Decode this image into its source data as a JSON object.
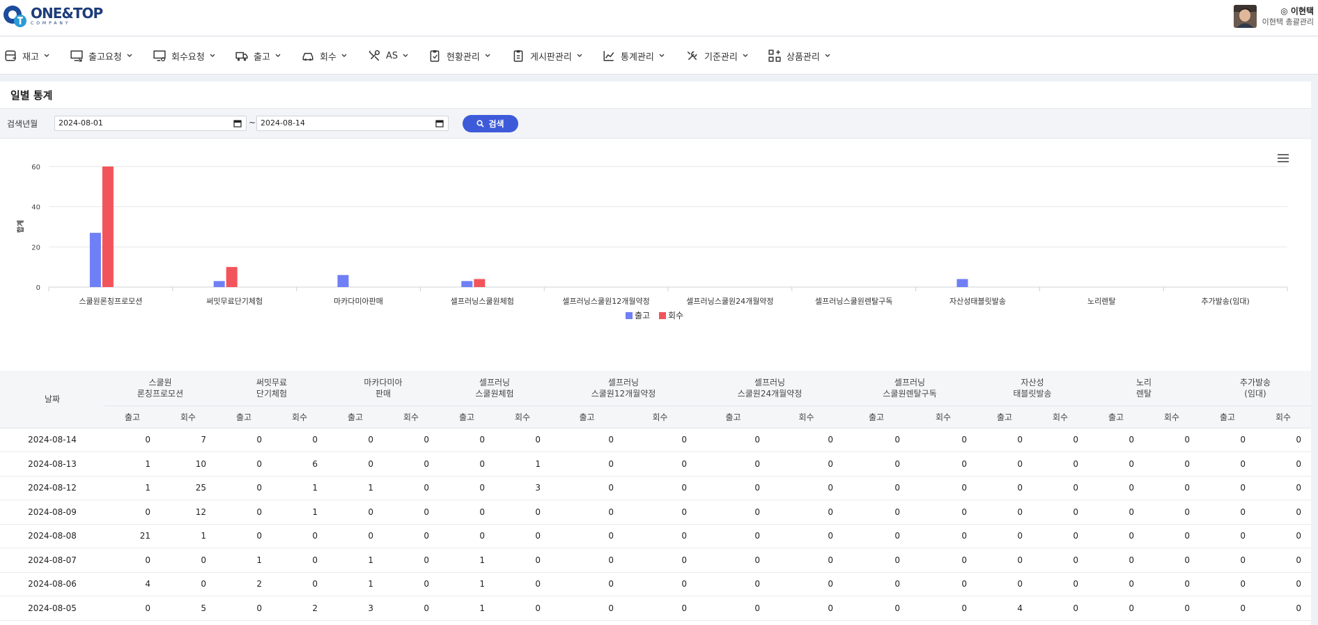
{
  "header": {
    "logo_name": "ONE&TOP",
    "logo_sub": "COMPANY",
    "user_name": "◎ 이현택",
    "user_role": "이현택 총괄관리"
  },
  "nav": [
    {
      "label": "재고",
      "icon": "inventory-icon"
    },
    {
      "label": "출고요청",
      "icon": "monitor-export-icon"
    },
    {
      "label": "회수요청",
      "icon": "monitor-search-icon"
    },
    {
      "label": "출고",
      "icon": "truck-icon"
    },
    {
      "label": "회수",
      "icon": "car-icon"
    },
    {
      "label": "AS",
      "icon": "tools-icon"
    },
    {
      "label": "현황관리",
      "icon": "clipboard-icon"
    },
    {
      "label": "게시판관리",
      "icon": "board-icon"
    },
    {
      "label": "통계관리",
      "icon": "line-chart-icon"
    },
    {
      "label": "기준관리",
      "icon": "wrench-icon"
    },
    {
      "label": "상품관리",
      "icon": "grid-plus-icon"
    }
  ],
  "page": {
    "title": "일별 통계"
  },
  "search": {
    "label": "검색년월",
    "start": "2024-08-01",
    "end": "2024-08-14",
    "tilde": "~",
    "button": "검색"
  },
  "chart_data": {
    "type": "bar",
    "title": "",
    "xlabel": "",
    "ylabel": "합계",
    "ylim": [
      0,
      60
    ],
    "yticks": [
      0,
      20,
      40,
      60
    ],
    "grid": true,
    "legend": "bottom",
    "categories": [
      "스쿨원론칭프로모션",
      "써밋무료단기체험",
      "마카다미아판매",
      "셀프러닝스쿨원체험",
      "셀프러닝스쿨원12개월약정",
      "셀프러닝스쿨원24개월약정",
      "셀프러닝스쿨원렌탈구독",
      "자산성태블릿발송",
      "노리렌탈",
      "추가발송(임대)"
    ],
    "series": [
      {
        "name": "출고",
        "color": "#6f7ff5",
        "values": [
          27,
          3,
          6,
          3,
          0,
          0,
          0,
          4,
          0,
          0
        ]
      },
      {
        "name": "회수",
        "color": "#f2545b",
        "values": [
          60,
          10,
          0,
          4,
          0,
          0,
          0,
          0,
          0,
          0
        ]
      }
    ]
  },
  "table": {
    "date_header": "날짜",
    "groups": [
      [
        "스쿨원",
        "론칭프로모션"
      ],
      [
        "써밋무료",
        "단기체험"
      ],
      [
        "마카다미아",
        "판매"
      ],
      [
        "셀프러닝",
        "스쿨원체험"
      ],
      [
        "셀프러닝",
        "스쿨원12개월약정"
      ],
      [
        "셀프러닝",
        "스쿨원24개월약정"
      ],
      [
        "셀프러닝",
        "스쿨원렌탈구독"
      ],
      [
        "자산성",
        "태블릿발송"
      ],
      [
        "노리",
        "렌탈"
      ],
      [
        "추가발송",
        "(임대)"
      ]
    ],
    "sub_out": "출고",
    "sub_in": "회수",
    "rows": [
      {
        "date": "2024-08-14",
        "values": [
          0,
          7,
          0,
          0,
          0,
          0,
          0,
          0,
          0,
          0,
          0,
          0,
          0,
          0,
          0,
          0,
          0,
          0,
          0,
          0
        ]
      },
      {
        "date": "2024-08-13",
        "values": [
          1,
          10,
          0,
          6,
          0,
          0,
          0,
          1,
          0,
          0,
          0,
          0,
          0,
          0,
          0,
          0,
          0,
          0,
          0,
          0
        ]
      },
      {
        "date": "2024-08-12",
        "values": [
          1,
          25,
          0,
          1,
          1,
          0,
          0,
          3,
          0,
          0,
          0,
          0,
          0,
          0,
          0,
          0,
          0,
          0,
          0,
          0
        ]
      },
      {
        "date": "2024-08-09",
        "values": [
          0,
          12,
          0,
          1,
          0,
          0,
          0,
          0,
          0,
          0,
          0,
          0,
          0,
          0,
          0,
          0,
          0,
          0,
          0,
          0
        ]
      },
      {
        "date": "2024-08-08",
        "values": [
          21,
          1,
          0,
          0,
          0,
          0,
          0,
          0,
          0,
          0,
          0,
          0,
          0,
          0,
          0,
          0,
          0,
          0,
          0,
          0
        ]
      },
      {
        "date": "2024-08-07",
        "values": [
          0,
          0,
          1,
          0,
          1,
          0,
          1,
          0,
          0,
          0,
          0,
          0,
          0,
          0,
          0,
          0,
          0,
          0,
          0,
          0
        ]
      },
      {
        "date": "2024-08-06",
        "values": [
          4,
          0,
          2,
          0,
          1,
          0,
          1,
          0,
          0,
          0,
          0,
          0,
          0,
          0,
          0,
          0,
          0,
          0,
          0,
          0
        ]
      },
      {
        "date": "2024-08-05",
        "values": [
          0,
          5,
          0,
          2,
          3,
          0,
          1,
          0,
          0,
          0,
          0,
          0,
          0,
          0,
          4,
          0,
          0,
          0,
          0,
          0
        ]
      }
    ]
  }
}
